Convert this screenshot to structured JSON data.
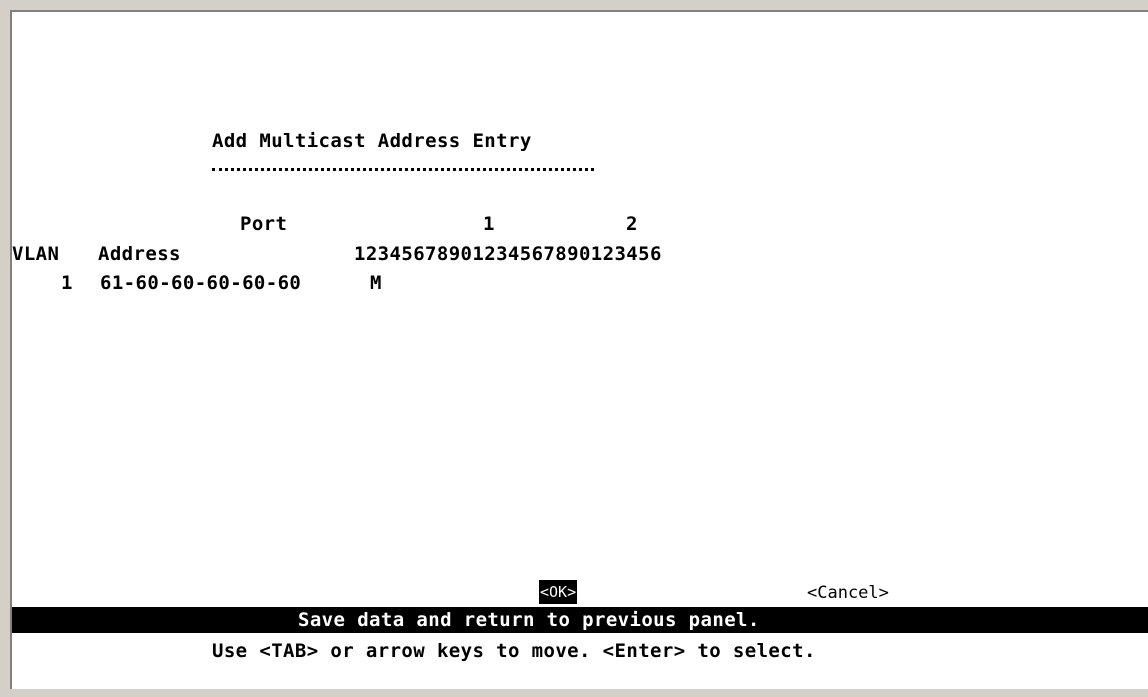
{
  "panel": {
    "title": "Add Multicast Address Entry",
    "title_underline": "==========================="
  },
  "table": {
    "port_label": "Port",
    "port_tens": [
      "1",
      "2"
    ],
    "headers": {
      "vlan": "VLAN",
      "address": "Address",
      "port_digits": "12345678901234567890123456"
    },
    "rows": [
      {
        "vlan": "1",
        "address": "61-60-60-60-60-60",
        "membership": "M"
      }
    ]
  },
  "buttons": {
    "ok": "<OK>",
    "cancel": "<Cancel>"
  },
  "status": {
    "message": "Save data and return to previous panel.",
    "help": "Use <TAB> or arrow keys to move. <Enter> to select."
  },
  "colors": {
    "background": "#ffffff",
    "foreground": "#000000",
    "highlight": "#000000",
    "frame": "#d4d0c8"
  }
}
